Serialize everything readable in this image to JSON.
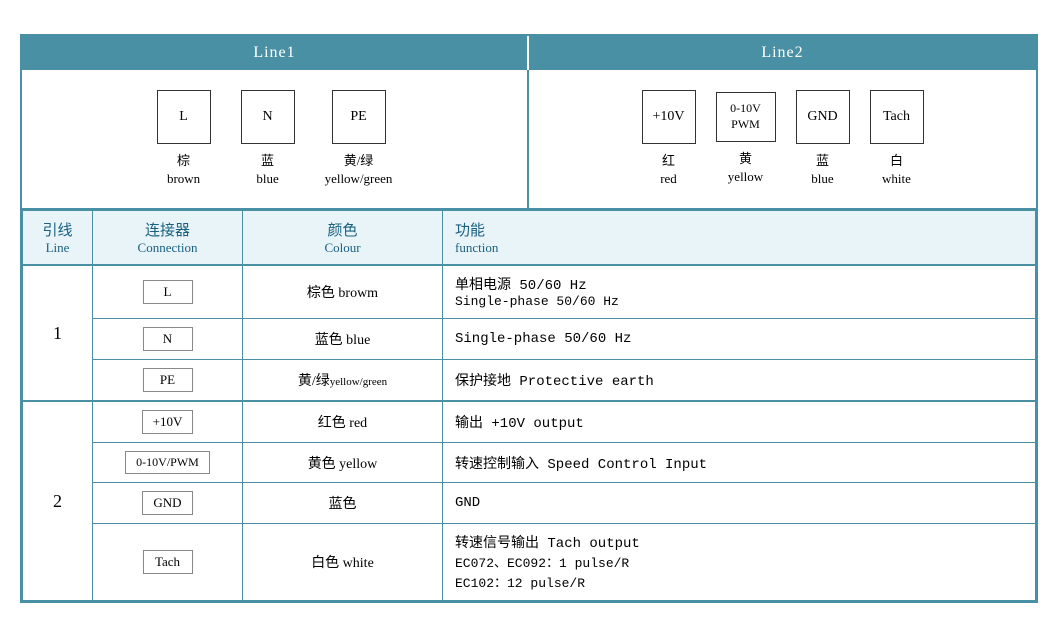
{
  "header": {
    "line1": "Line1",
    "line2": "Line2"
  },
  "diagram": {
    "line1_connectors": [
      {
        "id": "L",
        "label_zh": "棕",
        "label_en": "brown"
      },
      {
        "id": "N",
        "label_zh": "蓝",
        "label_en": "blue"
      },
      {
        "id": "PE",
        "label_zh": "黄/绿",
        "label_en": "yellow/green"
      }
    ],
    "line2_connectors": [
      {
        "id": "+10V",
        "label_zh": "红",
        "label_en": "red"
      },
      {
        "id": "0-10V\nPWM",
        "label_zh": "黄",
        "label_en": "yellow"
      },
      {
        "id": "GND",
        "label_zh": "蓝",
        "label_en": "blue"
      },
      {
        "id": "Tach",
        "label_zh": "白",
        "label_en": "white"
      }
    ]
  },
  "table": {
    "headers": {
      "line": {
        "zh": "引线",
        "en": "Line"
      },
      "connection": {
        "zh": "连接器",
        "en": "Connection"
      },
      "colour": {
        "zh": "颜色",
        "en": "Colour"
      },
      "function": {
        "zh": "功能",
        "en": "function"
      }
    },
    "rows": [
      {
        "line_group": "1",
        "line_rowspan": 3,
        "connection": "L",
        "colour_zh": "棕色",
        "colour_en": "browm",
        "function": "单相电源 50/60 Hz\nSingle-phase 50/60 Hz",
        "function_line2": "Single-phase 50/60 Hz"
      },
      {
        "line_group": null,
        "connection": "N",
        "colour_zh": "蓝色",
        "colour_en": "blue",
        "function": "Single-phase 50/60 Hz",
        "function_line2": null
      },
      {
        "line_group": null,
        "connection": "PE",
        "colour_zh": "黄/绿",
        "colour_en": "yellow/green",
        "colour_en_small": true,
        "function": "保护接地 Protective earth"
      },
      {
        "line_group": "2",
        "line_rowspan": 4,
        "connection": "+10V",
        "colour_zh": "红色",
        "colour_en": "red",
        "function": "输出 +10V output"
      },
      {
        "line_group": null,
        "connection": "0-10V/PWM",
        "conn_box": true,
        "colour_zh": "黄色",
        "colour_en": "yellow",
        "function": "转速控制输入 Speed Control Input"
      },
      {
        "line_group": null,
        "connection": "GND",
        "colour_zh": "蓝色",
        "colour_en": "",
        "function": "GND"
      },
      {
        "line_group": null,
        "connection": "Tach",
        "colour_zh": "白色",
        "colour_en": "white",
        "function": "转速信号输出 Tach output\nEC072、EC092：1 pulse/R\nEC102：12 pulse/R",
        "function_line2": "EC072、EC092：1 pulse/R",
        "function_line3": "EC102：12 pulse/R"
      }
    ]
  }
}
